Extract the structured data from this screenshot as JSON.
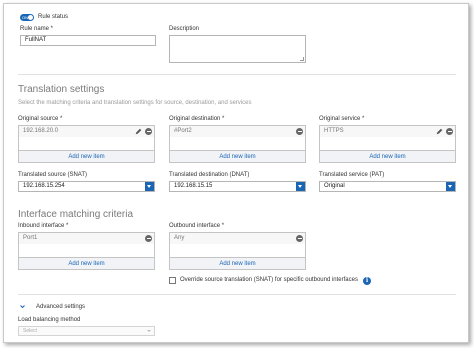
{
  "rule": {
    "status_label": "Rule status",
    "toggle_text": "ON",
    "name_label": "Rule name *",
    "name_value": "FullNAT",
    "description_label": "Description"
  },
  "translation": {
    "title": "Translation settings",
    "hint": "Select the matching criteria and translation settings for source, destination, and services",
    "original_source": {
      "label": "Original source *",
      "item": "192.168.20.0",
      "add": "Add new item"
    },
    "original_destination": {
      "label": "Original destination *",
      "item": "#Port2",
      "add": "Add new item"
    },
    "original_service": {
      "label": "Original service *",
      "item": "HTTPS",
      "add": "Add new item"
    },
    "translated_source": {
      "label": "Translated source (SNAT)",
      "value": "192.168.15.254"
    },
    "translated_destination": {
      "label": "Translated destination (DNAT)",
      "value": "192.168.15.15"
    },
    "translated_service": {
      "label": "Translated service (PAT)",
      "value": "Original"
    }
  },
  "interface": {
    "title": "Interface matching criteria",
    "inbound": {
      "label": "Inbound interface *",
      "item": "Port1",
      "add": "Add new item"
    },
    "outbound": {
      "label": "Outbound interface *",
      "item": "Any",
      "add": "Add new item"
    },
    "override_label": "Override source translation (SNAT) for specific outbound interfaces",
    "info_glyph": "i"
  },
  "advanced": {
    "title": "Advanced settings",
    "lb_label": "Load balancing method",
    "lb_value": "Select"
  },
  "colors": {
    "accent": "#1a66b5"
  },
  "icons": [
    "toggle-switch",
    "pencil-icon",
    "remove-icon",
    "dropdown-caret-icon",
    "info-icon",
    "chevron-down-icon",
    "resize-grip-icon"
  ]
}
